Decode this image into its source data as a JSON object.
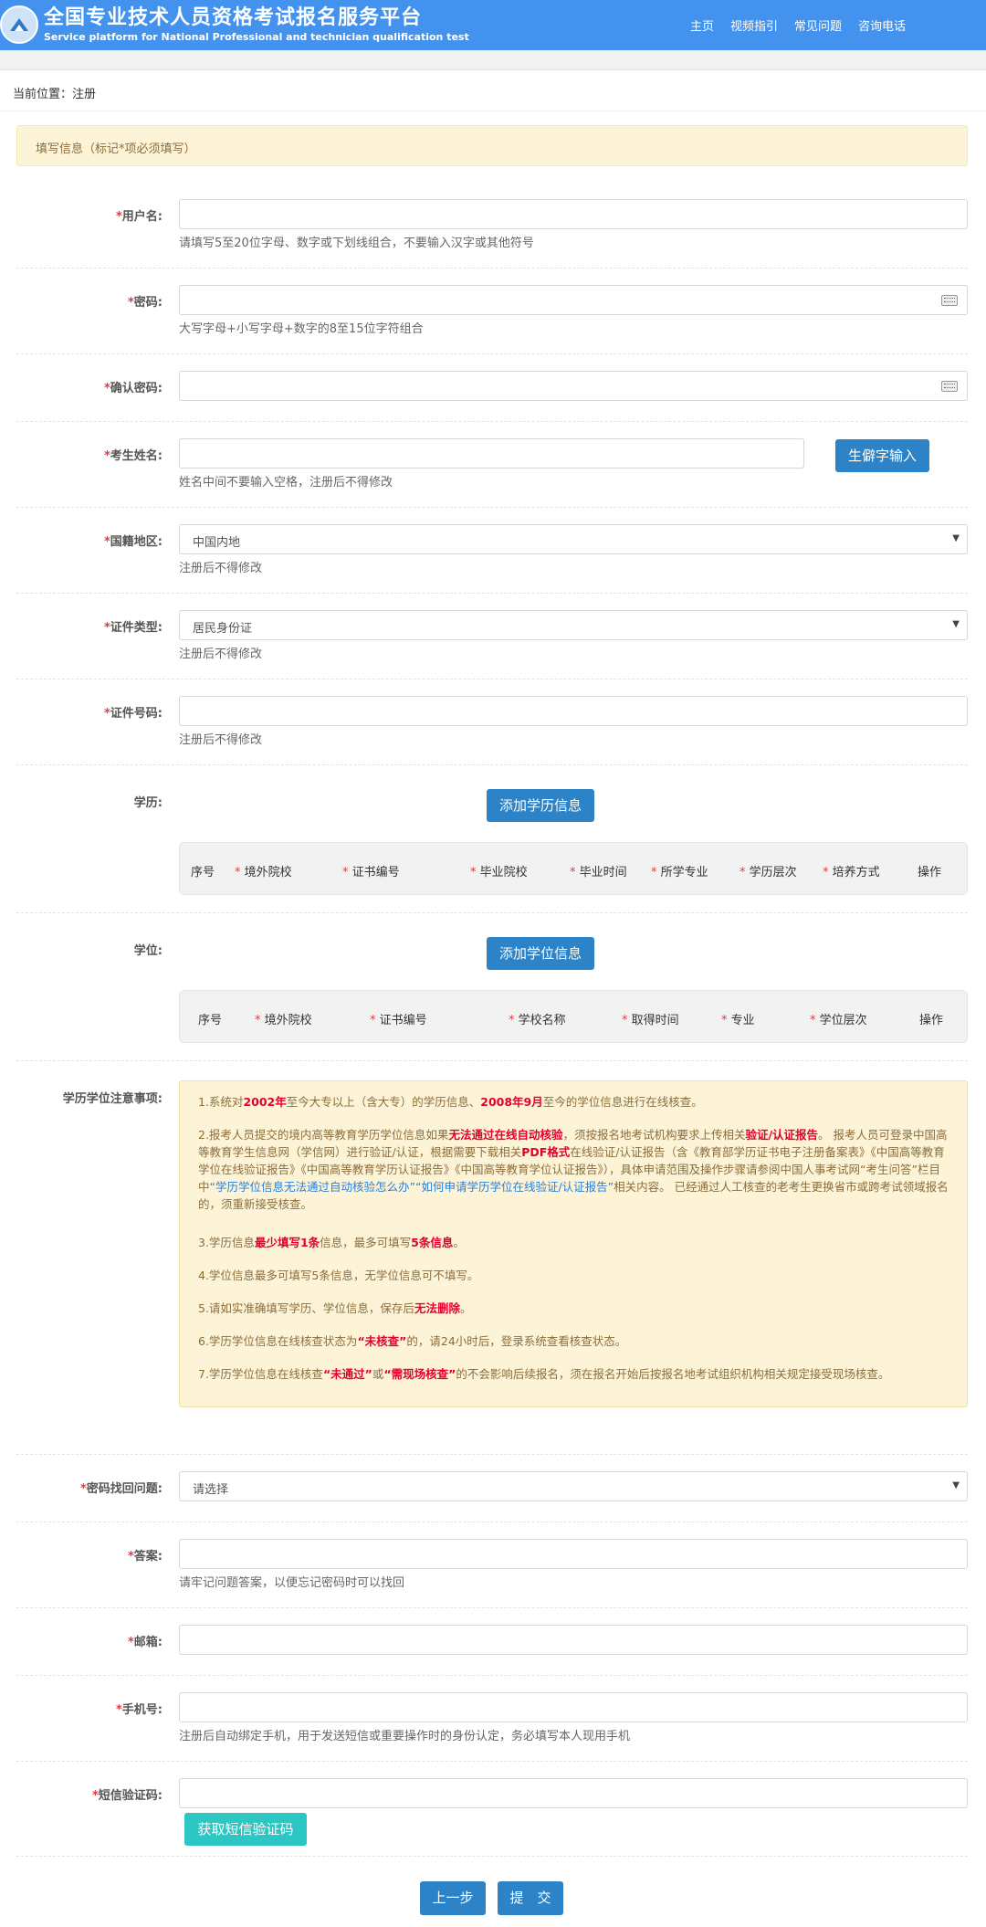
{
  "header": {
    "title": "全国专业技术人员资格考试报名服务平台",
    "subtitle": "Service platform for National Professional and technician qualification test",
    "nav": [
      "主页",
      "视频指引",
      "常见问题",
      "咨询电话"
    ]
  },
  "breadcrumb": "当前位置：注册",
  "notice": "填写信息（标记*项必须填写）",
  "form": {
    "username": {
      "label": "用户名:",
      "hint": "请填写5至20位字母、数字或下划线组合，不要输入汉字或其他符号"
    },
    "password": {
      "label": "密码:",
      "hint": "大写字母+小写字母+数字的8至15位字符组合"
    },
    "confirm_password": {
      "label": "确认密码:"
    },
    "name": {
      "label": "考生姓名:",
      "hint": "姓名中间不要输入空格，注册后不得修改",
      "button": "生僻字输入"
    },
    "region": {
      "label": "国籍地区:",
      "value": "中国内地",
      "hint": "注册后不得修改"
    },
    "id_type": {
      "label": "证件类型:",
      "value": "居民身份证",
      "hint": "注册后不得修改"
    },
    "id_number": {
      "label": "证件号码:",
      "hint": "注册后不得修改"
    },
    "education": {
      "label": "学历:",
      "button": "添加学历信息",
      "columns": [
        "序号",
        "境外院校",
        "证书编号",
        "毕业院校",
        "毕业时间",
        "所学专业",
        "学历层次",
        "培养方式",
        "操作"
      ]
    },
    "degree": {
      "label": "学位:",
      "button": "添加学位信息",
      "columns": [
        "序号",
        "境外院校",
        "证书编号",
        "学校名称",
        "取得时间",
        "专业",
        "学位层次",
        "操作"
      ]
    },
    "notes": {
      "label": "学历学位注意事项:",
      "n1": {
        "a": "1.系统对",
        "b": "2002年",
        "c": "至今大专以上（含大专）的学历信息、",
        "d": "2008年9月",
        "e": "至今的学位信息进行在线核查。"
      },
      "n2": {
        "a": "2.报考人员提交的境内高等教育学历学位信息如果",
        "b": "无法通过在线自动核验",
        "c": "，须按报名地考试机构要求上传相关",
        "d": "验证/认证报告",
        "e": "。 报考人员可登录中国高等教育学生信息网（学信网）进行验证/认证，根据需要下载相关",
        "f": "PDF格式",
        "g": "在线验证/认证报告（含《教育部学历证书电子注册备案表》《中国高等教育学位在线验证报告》《中国高等教育学历认证报告》《中国高等教育学位认证报告》），具体申请范围及操作步骤请参阅中国人事考试网“考生问答”栏目中",
        "h": "“学历学位信息无法通过自动核验怎么办”",
        "i": "“如何申请学历学位在线验证/认证报告”",
        "j": "相关内容。 已经通过人工核查的老考生更换省市或跨考试领域报名的，须重新接受核查。"
      },
      "n3": {
        "a": "3.学历信息",
        "b": "最少填写1条",
        "c": "信息，最多可填写",
        "d": "5条信息",
        "e": "。"
      },
      "n4": "4.学位信息最多可填写5条信息，无学位信息可不填写。",
      "n5": {
        "a": "5.请如实准确填写学历、学位信息，保存后",
        "b": "无法删除",
        "c": "。"
      },
      "n6": {
        "a": "6.学历学位信息在线核查状态为",
        "b": "“未核查”",
        "c": "的，请24小时后，登录系统查看核查状态。"
      },
      "n7": {
        "a": "7.学历学位信息在线核查",
        "b": "“未通过”",
        "c": "或",
        "d": "“需现场核查”",
        "e": "的不会影响后续报名，须在报名开始后按报名地考试组织机构相关规定接受现场核查。"
      }
    },
    "question": {
      "label": "密码找回问题:",
      "value": "请选择"
    },
    "answer": {
      "label": "答案:",
      "hint": "请牢记问题答案，以便忘记密码时可以找回"
    },
    "email": {
      "label": "邮箱:"
    },
    "phone": {
      "label": "手机号:",
      "hint": "注册后自动绑定手机，用于发送短信或重要操作时的身份认定，务必填写本人现用手机"
    },
    "sms": {
      "label": "短信验证码:",
      "button": "获取短信验证码"
    }
  },
  "actions": {
    "prev": "上一步",
    "submit": "提　交"
  }
}
